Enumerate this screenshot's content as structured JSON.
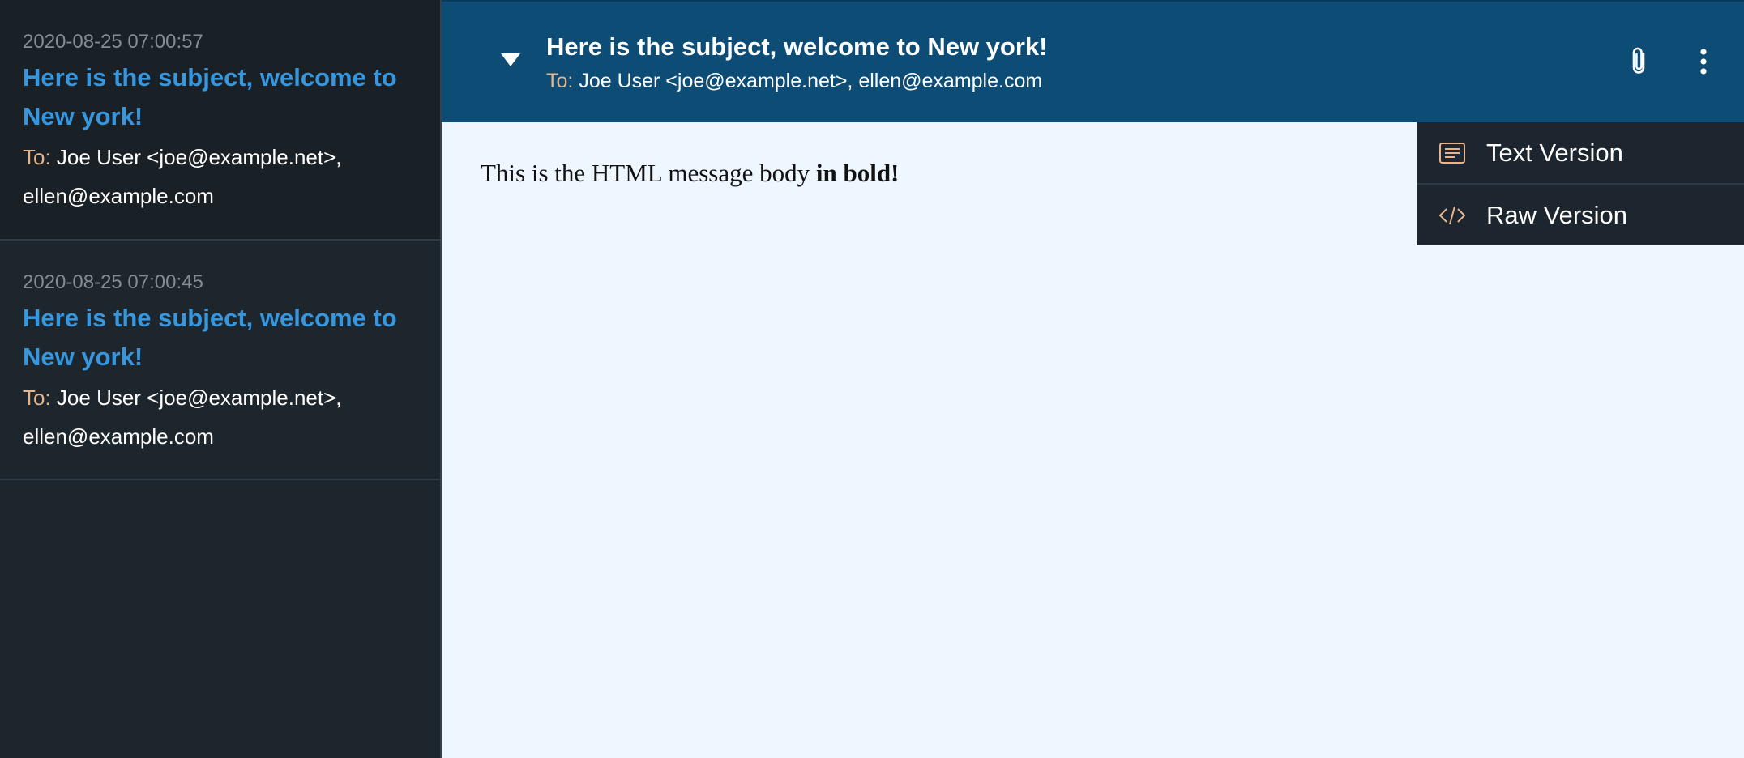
{
  "message_list": [
    {
      "date": "2020-08-25 07:00:57",
      "subject": "Here is the subject, welcome to New york!",
      "to_label": "To:",
      "recipients": "Joe User <joe@example.net>, ellen@example.com",
      "selected": true
    },
    {
      "date": "2020-08-25 07:00:45",
      "subject": "Here is the subject, welcome to New york!",
      "to_label": "To:",
      "recipients": "Joe User <joe@example.net>, ellen@example.com",
      "selected": false
    }
  ],
  "header": {
    "subject": "Here is the subject, welcome to New york!",
    "to_label": "To:",
    "recipients": "Joe User <joe@example.net>, ellen@example.com",
    "collapse_icon": "triangle-down-icon",
    "attachment_icon": "paperclip-icon",
    "more_icon": "vertical-dots-icon"
  },
  "body": {
    "text": "This is the HTML message body",
    "bold_text": "in bold!"
  },
  "menu": {
    "items": [
      {
        "label": "Text Version",
        "icon": "text-document-icon"
      },
      {
        "label": "Raw Version",
        "icon": "code-icon"
      }
    ]
  },
  "colors": {
    "sidebar_bg": "#1d252d",
    "header_bg": "#0d4c75",
    "subject_link": "#3797de",
    "to_label": "#e8b48a",
    "content_bg": "#eef6ff"
  }
}
